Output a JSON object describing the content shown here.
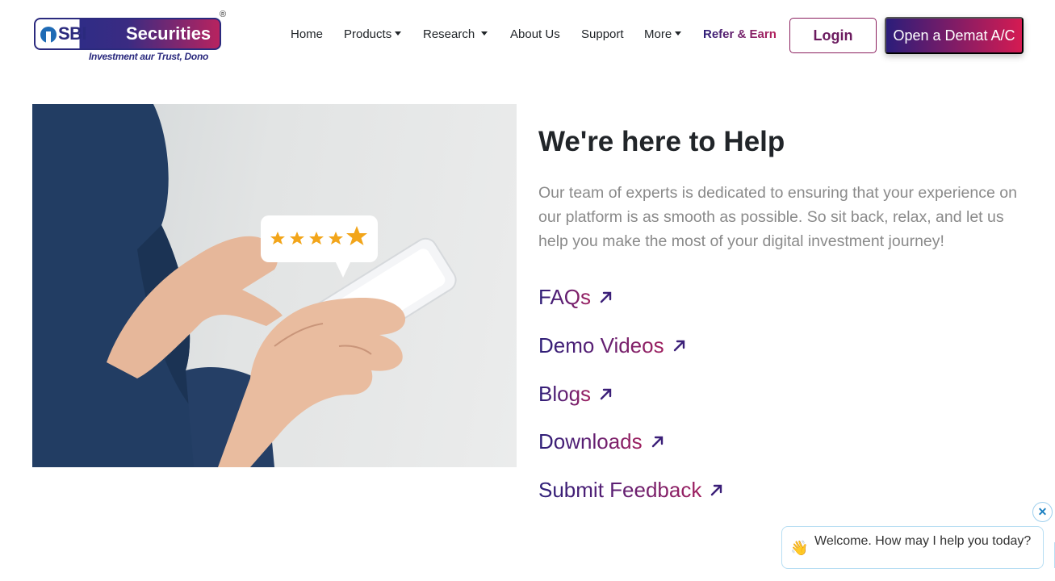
{
  "brand": {
    "logo_sbi": "SBI",
    "logo_securities": "Securities",
    "logo_registered": "®",
    "tagline": "Investment aur Trust, Dono",
    "colors": {
      "primary": "#2b2a7e",
      "accent": "#d51b52",
      "link_start": "#2d1f78",
      "link_end": "#a0205f"
    }
  },
  "nav": {
    "items": [
      {
        "label": "Home",
        "dropdown": false
      },
      {
        "label": "Products",
        "dropdown": true
      },
      {
        "label": "Research",
        "dropdown": true
      },
      {
        "label": "About Us",
        "dropdown": false
      },
      {
        "label": "Support",
        "dropdown": false
      },
      {
        "label": "More",
        "dropdown": true
      }
    ],
    "refer": "Refer & Earn",
    "login": "Login",
    "open_demat": "Open a Demat A/C"
  },
  "main": {
    "heading": "We're here to Help",
    "description": "Our team of experts is dedicated to ensuring that your experience on our platform is as smooth as possible. So sit back, relax, and let us help you make the most of your digital investment journey!",
    "links": [
      {
        "label": "FAQs",
        "icon": "arrow-up-right-icon"
      },
      {
        "label": "Demo Videos",
        "icon": "arrow-up-right-icon"
      },
      {
        "label": "Blogs",
        "icon": "arrow-up-right-icon"
      },
      {
        "label": "Downloads",
        "icon": "arrow-up-right-icon"
      },
      {
        "label": "Submit Feedback",
        "icon": "arrow-up-right-icon"
      }
    ],
    "hero_image": {
      "rating_stars": 5,
      "icon": "star-icon"
    }
  },
  "chat": {
    "welcome": "Welcome. How may I help you today?",
    "close_icon": "close-icon",
    "hand_icon": "waving-hand-icon"
  }
}
